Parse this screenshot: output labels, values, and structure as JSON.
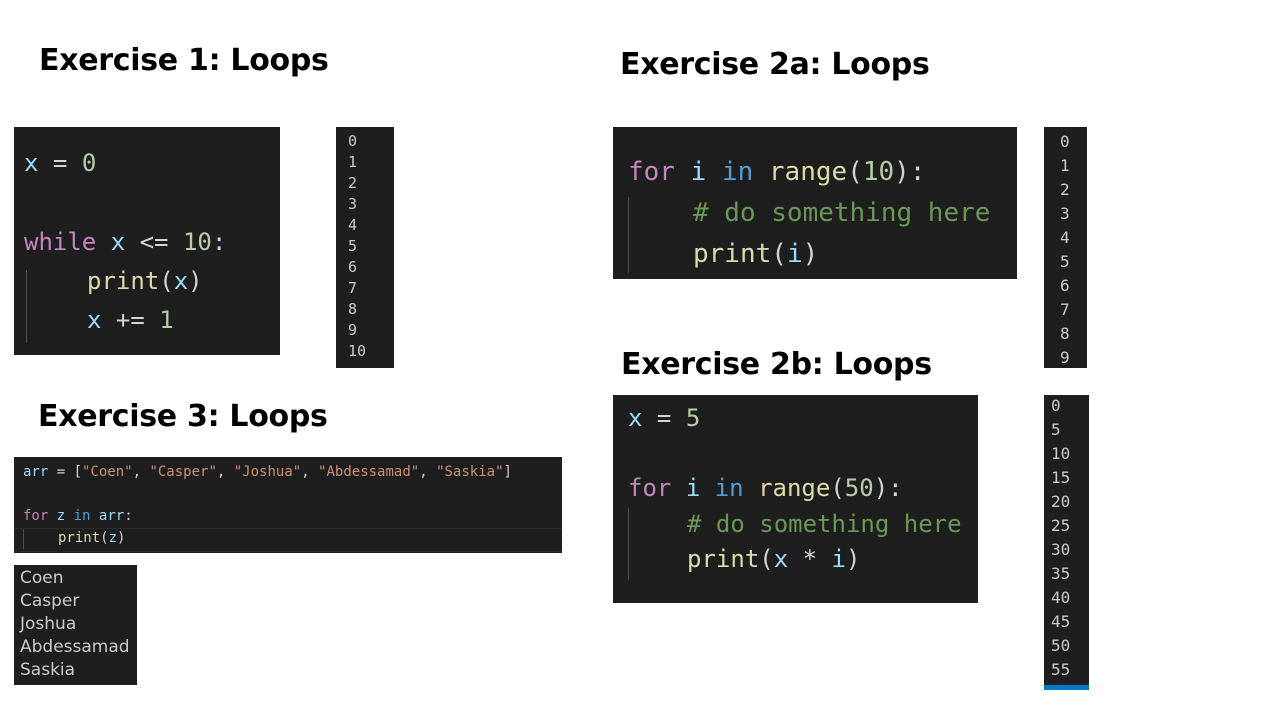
{
  "ex1": {
    "title": "Exercise 1: Loops",
    "code": {
      "l1_var": "x",
      "l1_op": " = ",
      "l1_num": "0",
      "l2_kw": "while",
      "l2_var": "x",
      "l2_op": " <= ",
      "l2_num": "10",
      "l2_colon": ":",
      "l3_fn": "print",
      "l3_open": "(",
      "l3_var": "x",
      "l3_close": ")",
      "l4_var": "x",
      "l4_op": " += ",
      "l4_num": "1"
    },
    "output": [
      "0",
      "1",
      "2",
      "3",
      "4",
      "5",
      "6",
      "7",
      "8",
      "9",
      "10"
    ]
  },
  "ex2a": {
    "title": "Exercise 2a: Loops",
    "code": {
      "l1_kw": "for",
      "l1_var": "i",
      "l1_in": "in",
      "l1_fn": "range",
      "l1_open": "(",
      "l1_num": "10",
      "l1_close": "):",
      "l2_comment": "# do something here",
      "l3_fn": "print",
      "l3_open": "(",
      "l3_var": "i",
      "l3_close": ")"
    },
    "output": [
      "0",
      "1",
      "2",
      "3",
      "4",
      "5",
      "6",
      "7",
      "8",
      "9"
    ]
  },
  "ex2b": {
    "title": "Exercise 2b: Loops",
    "code": {
      "l1_var": "x",
      "l1_op": " = ",
      "l1_num": "5",
      "l2_kw": "for",
      "l2_var": "i",
      "l2_in": "in",
      "l2_fn": "range",
      "l2_open": "(",
      "l2_num": "50",
      "l2_close": "):",
      "l3_comment": "# do something here",
      "l4_fn": "print",
      "l4_open": "(",
      "l4_var1": "x",
      "l4_op": " * ",
      "l4_var2": "i",
      "l4_close": ")"
    },
    "output": [
      "0",
      "5",
      "10",
      "15",
      "20",
      "25",
      "30",
      "35",
      "40",
      "45",
      "50",
      "55"
    ]
  },
  "ex3": {
    "title": "Exercise 3: Loops",
    "code": {
      "l1_var": "arr",
      "l1_open": " = [",
      "s1": "\"Coen\"",
      "s2": "\"Casper\"",
      "s3": "\"Joshua\"",
      "s4": "\"Abdessamad\"",
      "s5": "\"Saskia\"",
      "sep": ", ",
      "l1_close": "]",
      "l2_kw": "for",
      "l2_var": "z",
      "l2_in": "in",
      "l2_arr": "arr",
      "l2_colon": ":",
      "l3_fn": "print",
      "l3_open": "(",
      "l3_var": "z",
      "l3_close": ")"
    },
    "output": [
      "Coen",
      "Casper",
      "Joshua",
      "Abdessamad",
      "Saskia"
    ]
  },
  "colors": {
    "editor_bg": "#1e1e1e",
    "variable": "#9cdcfe",
    "keyword_control": "#c586c0",
    "keyword": "#569cd6",
    "function": "#dcdcaa",
    "number": "#b5cea8",
    "string": "#ce9178",
    "comment": "#6a9955",
    "scrollbar_accent": "#007acc"
  }
}
